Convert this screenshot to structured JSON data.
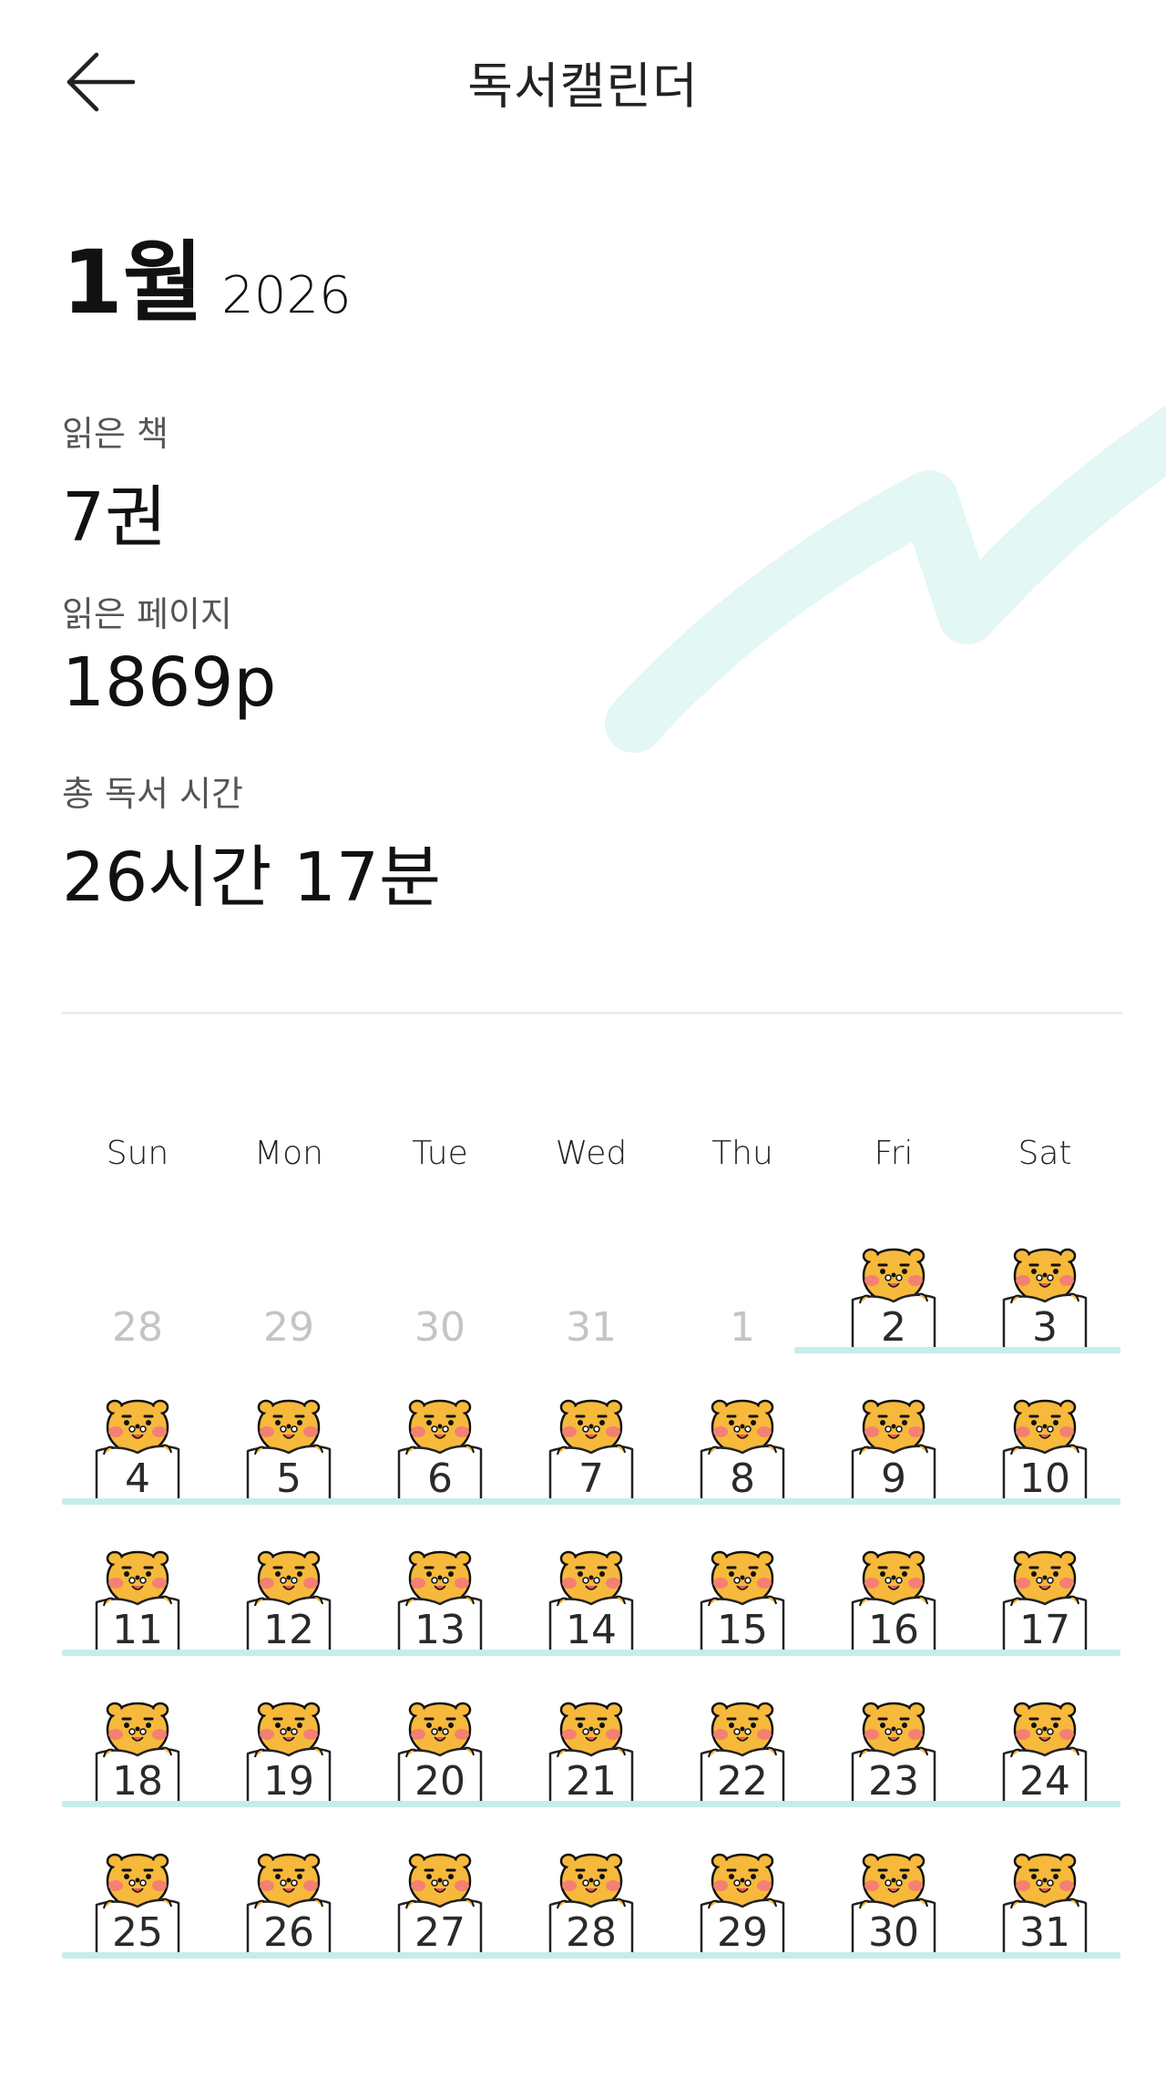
{
  "header": {
    "title": "독서캘린더",
    "back_icon": "arrow-left-icon"
  },
  "month_header": {
    "month": "1월",
    "year": "2026"
  },
  "stats": [
    {
      "label": "읽은 책",
      "value": "7권"
    },
    {
      "label": "읽은 페이지",
      "value": "1869p"
    },
    {
      "label": "총 독서 시간",
      "value": "26시간 17분"
    }
  ],
  "colors": {
    "accent_line": "#c6ecec",
    "decoration": "#e3f7f5",
    "sticker_face": "#f6b93b",
    "sticker_cheek": "#f47a7a"
  },
  "calendar": {
    "weekdays": [
      "Sun",
      "Mon",
      "Tue",
      "Wed",
      "Thu",
      "Fri",
      "Sat"
    ],
    "weeks": [
      [
        {
          "day": "28",
          "muted": true,
          "sticker": false
        },
        {
          "day": "29",
          "muted": true,
          "sticker": false
        },
        {
          "day": "30",
          "muted": true,
          "sticker": false
        },
        {
          "day": "31",
          "muted": true,
          "sticker": false
        },
        {
          "day": "1",
          "muted": true,
          "sticker": false
        },
        {
          "day": "2",
          "muted": false,
          "sticker": true
        },
        {
          "day": "3",
          "muted": false,
          "sticker": true
        }
      ],
      [
        {
          "day": "4",
          "muted": false,
          "sticker": true
        },
        {
          "day": "5",
          "muted": false,
          "sticker": true
        },
        {
          "day": "6",
          "muted": false,
          "sticker": true
        },
        {
          "day": "7",
          "muted": false,
          "sticker": true
        },
        {
          "day": "8",
          "muted": false,
          "sticker": true
        },
        {
          "day": "9",
          "muted": false,
          "sticker": true
        },
        {
          "day": "10",
          "muted": false,
          "sticker": true
        }
      ],
      [
        {
          "day": "11",
          "muted": false,
          "sticker": true
        },
        {
          "day": "12",
          "muted": false,
          "sticker": true
        },
        {
          "day": "13",
          "muted": false,
          "sticker": true
        },
        {
          "day": "14",
          "muted": false,
          "sticker": true
        },
        {
          "day": "15",
          "muted": false,
          "sticker": true
        },
        {
          "day": "16",
          "muted": false,
          "sticker": true
        },
        {
          "day": "17",
          "muted": false,
          "sticker": true
        }
      ],
      [
        {
          "day": "18",
          "muted": false,
          "sticker": true
        },
        {
          "day": "19",
          "muted": false,
          "sticker": true
        },
        {
          "day": "20",
          "muted": false,
          "sticker": true
        },
        {
          "day": "21",
          "muted": false,
          "sticker": true
        },
        {
          "day": "22",
          "muted": false,
          "sticker": true
        },
        {
          "day": "23",
          "muted": false,
          "sticker": true
        },
        {
          "day": "24",
          "muted": false,
          "sticker": true
        }
      ],
      [
        {
          "day": "25",
          "muted": false,
          "sticker": true
        },
        {
          "day": "26",
          "muted": false,
          "sticker": true
        },
        {
          "day": "27",
          "muted": false,
          "sticker": true
        },
        {
          "day": "28",
          "muted": false,
          "sticker": true
        },
        {
          "day": "29",
          "muted": false,
          "sticker": true
        },
        {
          "day": "30",
          "muted": false,
          "sticker": true
        },
        {
          "day": "31",
          "muted": false,
          "sticker": true
        }
      ]
    ]
  }
}
